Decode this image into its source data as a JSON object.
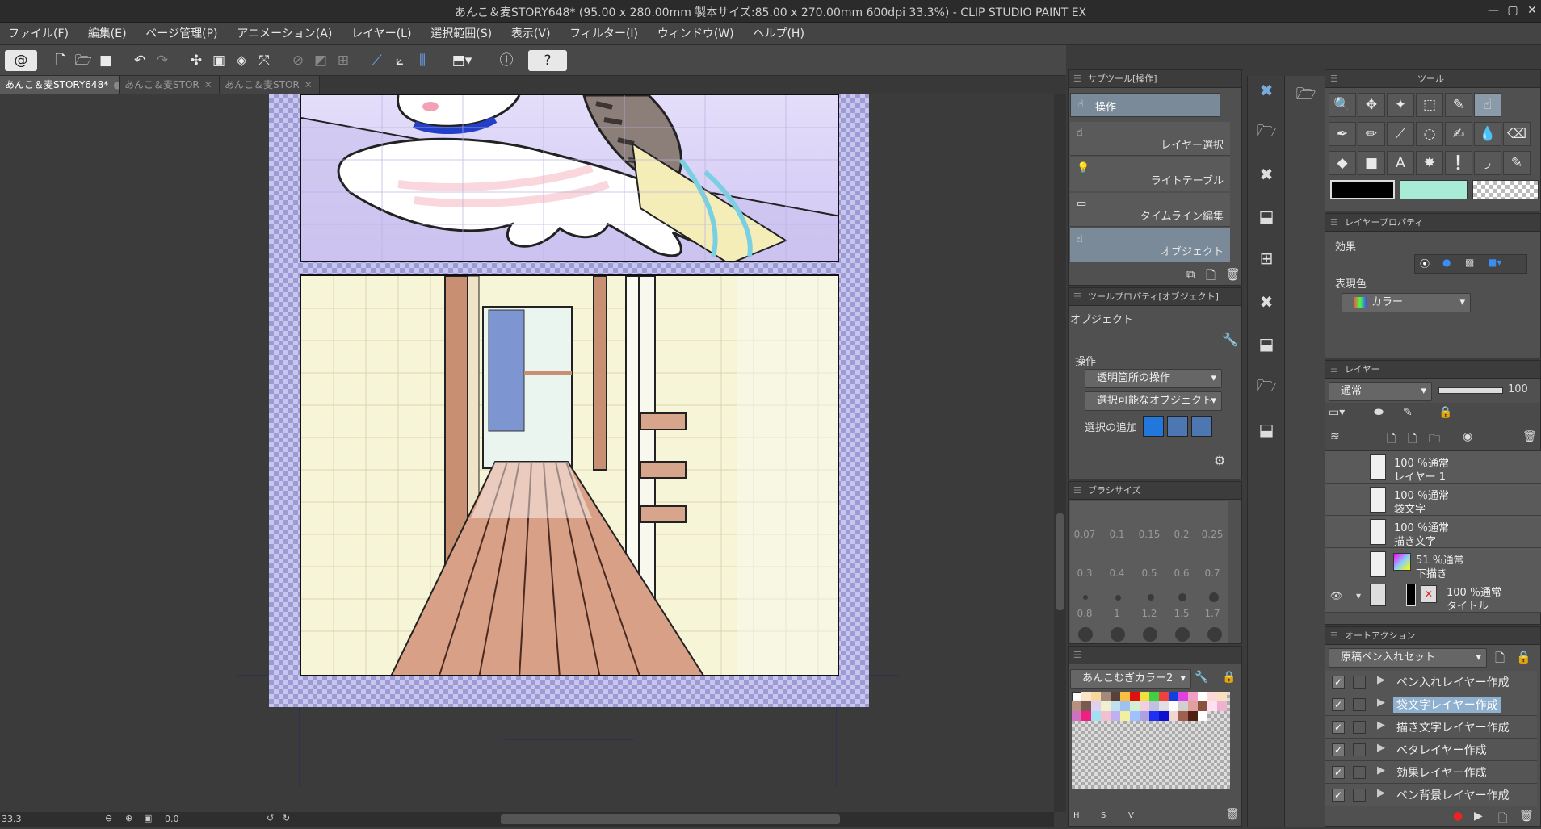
{
  "window": {
    "title": "あんこ＆麦STORY648* (95.00 x 280.00mm 製本サイズ:85.00 x 270.00mm 600dpi 33.3%)  - CLIP STUDIO PAINT EX",
    "minimize": "—",
    "maximize": "▢",
    "close": "✕"
  },
  "menu": [
    "ファイル(F)",
    "編集(E)",
    "ページ管理(P)",
    "アニメーション(A)",
    "レイヤー(L)",
    "選択範囲(S)",
    "表示(V)",
    "フィルター(I)",
    "ウィンドウ(W)",
    "ヘルプ(H)"
  ],
  "tabs": [
    {
      "label": "あんこ＆麦STORY648*"
    },
    {
      "label": "あんこ＆麦STOR"
    },
    {
      "label": "あんこ＆麦STOR"
    }
  ],
  "status": {
    "zoom": "33.3",
    "angle": "0.0"
  },
  "subtool": {
    "header": "サブツール[操作]",
    "group": "操作",
    "items": [
      "レイヤー選択",
      "ライトテーブル",
      "タイムライン編集",
      "オブジェクト"
    ]
  },
  "toolprop": {
    "header": "ツールプロパティ[オブジェクト]",
    "title": "オブジェクト",
    "section": "操作",
    "transparent": "透明箇所の操作",
    "selectable": "選択可能なオブジェクト",
    "add_label": "選択の追加"
  },
  "brush": {
    "header": "ブラシサイズ",
    "sizes": [
      "0.07",
      "0.1",
      "0.15",
      "0.2",
      "0.25",
      "0.3",
      "0.4",
      "0.5",
      "0.6",
      "0.7",
      "0.8",
      "1",
      "1.2",
      "1.5",
      "1.7"
    ]
  },
  "palette": {
    "name": "あんこむぎカラー2",
    "tabs": [
      "H",
      "S",
      "V"
    ]
  },
  "tools_header": "ツール",
  "layerprop": {
    "header": "レイヤープロパティ",
    "effect": "効果",
    "color_label": "表現色",
    "color_value": "カラー"
  },
  "layers": {
    "header": "レイヤー",
    "blend": "通常",
    "opacity": "100",
    "rows": [
      {
        "l1": "100 ％通常",
        "l2": "レイヤー 1"
      },
      {
        "l1": "100 ％通常",
        "l2": "袋文字"
      },
      {
        "l1": "100 ％通常",
        "l2": "描き文字"
      },
      {
        "l1": "51 ％通常",
        "l2": "下描き"
      },
      {
        "l1": "100 ％通常",
        "l2": "タイトル"
      }
    ]
  },
  "autoaction": {
    "header": "オートアクション",
    "set": "原稿ペン入れセット",
    "items": [
      "ペン入れレイヤー作成",
      "袋文字レイヤー作成",
      "描き文字レイヤー作成",
      "ベタレイヤー作成",
      "効果レイヤー作成",
      "ペン背景レイヤー作成"
    ]
  },
  "colors": {
    "main": "#000000",
    "sub": "#a8ecd8"
  }
}
